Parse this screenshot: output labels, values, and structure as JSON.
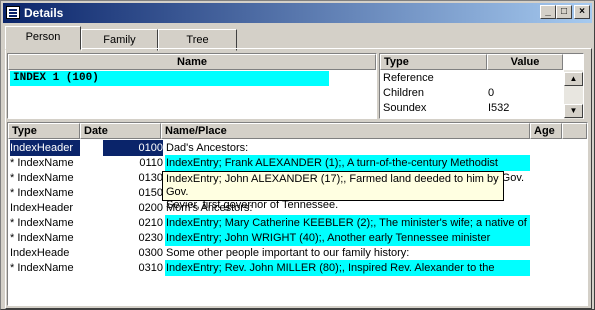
{
  "window": {
    "title": "Details"
  },
  "tabs": [
    "Person",
    "Family",
    "Tree"
  ],
  "name_pane": {
    "header": "Name",
    "value": "INDEX 1 (100)"
  },
  "ref_pane": {
    "type_header": "Type",
    "value_header": "Value",
    "rows": [
      {
        "type": "Reference",
        "value": ""
      },
      {
        "type": "Children",
        "value": "0"
      },
      {
        "type": "Soundex",
        "value": "I532"
      }
    ]
  },
  "events": {
    "headers": {
      "type": "Type",
      "date": "Date",
      "place": "Name/Place",
      "age": "Age"
    },
    "rows": [
      {
        "type": " IndexHeader",
        "date": "0100",
        "place": "Dad's Ancestors:",
        "highlight": false,
        "selected": true
      },
      {
        "type": "* IndexName",
        "date": "0110",
        "place": "IndexEntry; Frank ALEXANDER (1);, A turn-of-the-century Methodist",
        "highlight": true
      },
      {
        "type": "* IndexName",
        "date": "0130",
        "place": "IndexEntry; John ALEXANDER (17);, Farmed land deeded to him by Gov.",
        "highlight": false
      },
      {
        "type": "* IndexName",
        "date": "0150",
        "place": "Sevier, first governor of Tennessee.",
        "highlight": false
      },
      {
        "type": "  IndexHeader",
        "date": "0200",
        "place": "Mom's Ancestors:",
        "highlight": false
      },
      {
        "type": "* IndexName",
        "date": "0210",
        "place": "IndexEntry; Mary Catherine KEEBLER (2);, The minister's wife; a native of",
        "highlight": true
      },
      {
        "type": "* IndexName",
        "date": "0230",
        "place": "IndexEntry; John WRIGHT (40);, Another early Tennessee minister",
        "highlight": true
      },
      {
        "type": "  IndexHeade",
        "date": "0300",
        "place": "Some other people important to our family history:",
        "highlight": false
      },
      {
        "type": "* IndexName",
        "date": "0310",
        "place": "IndexEntry; Rev. John MILLER (80);, Inspired Rev. Alexander to the",
        "highlight": true
      }
    ]
  },
  "tooltip": {
    "line1": "IndexEntry; John ALEXANDER (17);, Farmed land deeded to him by Gov.",
    "line2": "Sevier, first governor of Tennessee."
  },
  "colors": {
    "highlight": "#00ffff",
    "selection": "#0a246a",
    "titlebar": "#0a246a"
  },
  "icons": {
    "app": "details-window-icon",
    "minimize": "minimize-icon",
    "maximize": "maximize-icon",
    "close": "close-icon",
    "scroll_up": "arrow-up-icon",
    "scroll_down": "arrow-down-icon"
  }
}
